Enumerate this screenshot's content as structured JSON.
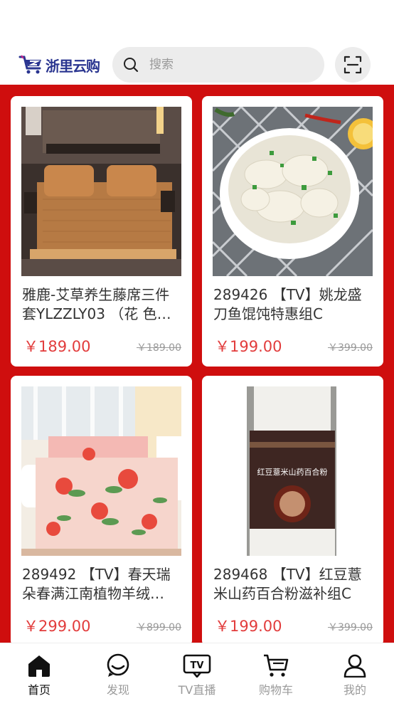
{
  "app": {
    "logo_text": "浙里云购"
  },
  "search": {
    "placeholder": "搜索"
  },
  "products": [
    {
      "title_line1": "雅鹿-艾草养生藤席三件",
      "title_line2": "套YLZZLY03 （花 色…",
      "price": "￥189.00",
      "original_price": "￥189.00"
    },
    {
      "title_line1": "289426 【TV】姚龙盛",
      "title_line2": "刀鱼馄饨特惠组C",
      "price": "￥199.00",
      "original_price": "￥399.00"
    },
    {
      "title_line1": "289492 【TV】春天瑞",
      "title_line2": "朵春满江南植物羊绒…",
      "price": "￥299.00",
      "original_price": "￥899.00"
    },
    {
      "title_line1": "289468 【TV】红豆薏",
      "title_line2": "米山药百合粉滋补组C",
      "price": "￥199.00",
      "original_price": "￥399.00"
    }
  ],
  "jar_label": "红豆薏米山药百合粉",
  "tabbar": [
    {
      "label": "首页",
      "icon": "home-icon",
      "active": true
    },
    {
      "label": "发现",
      "icon": "discover-icon",
      "active": false
    },
    {
      "label": "TV直播",
      "icon": "tv-icon",
      "active": false
    },
    {
      "label": "购物车",
      "icon": "cart-icon",
      "active": false
    },
    {
      "label": "我的",
      "icon": "user-icon",
      "active": false
    }
  ],
  "colors": {
    "accent": "#cf0e0e",
    "price": "#e23c3c",
    "brand": "#2a3590"
  }
}
